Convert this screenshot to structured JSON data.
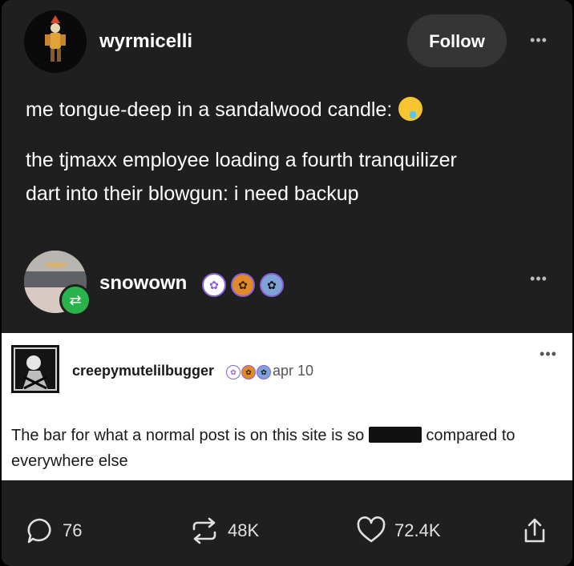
{
  "post": {
    "username": "wyrmicelli",
    "follow_label": "Follow",
    "more_label": "•••",
    "line1": "me tongue-deep in a sandalwood candle:",
    "line2": "the tjmaxx employee loading a fourth tranquilizer",
    "line3": "dart into their blowgun: i need backup"
  },
  "reblog": {
    "username": "snowown",
    "more_label": "•••",
    "badge_icon": "reblog-icon"
  },
  "quoted": {
    "username": "creepymutelilbugger",
    "date": "apr 10",
    "more_label": "•••",
    "text_before": "The bar for what a normal post is on this site is so",
    "text_after": "compared to",
    "text_line2": "everywhere else"
  },
  "actions": {
    "replies": "76",
    "reblogs": "48K",
    "likes": "72.4K"
  },
  "colors": {
    "card_bg": "#1f1f1f",
    "reblog_badge": "#2ab24c",
    "follow_bg": "#353535"
  }
}
